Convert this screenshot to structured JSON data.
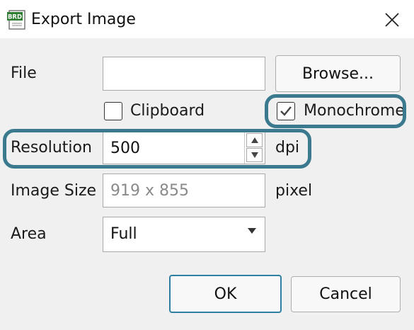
{
  "window": {
    "title": "Export Image",
    "app_icon": {
      "name": "brd-file-icon",
      "text": "BRD"
    },
    "close_icon": "close-icon"
  },
  "file": {
    "label": "File",
    "value": "",
    "browse_label": "Browse..."
  },
  "clipboard": {
    "label": "Clipboard",
    "checked": false
  },
  "monochrome": {
    "label": "Monochrome",
    "checked": true
  },
  "resolution": {
    "label": "Resolution",
    "value": "500",
    "unit": "dpi"
  },
  "image_size": {
    "label": "Image Size",
    "value": "919 x 855",
    "unit": "pixel"
  },
  "area": {
    "label": "Area",
    "selected": "Full"
  },
  "buttons": {
    "ok": "OK",
    "cancel": "Cancel"
  },
  "colors": {
    "highlight": "#3b7a8e",
    "default_button_border": "#2f7fa0",
    "app_icon_green": "#2e7d32"
  }
}
